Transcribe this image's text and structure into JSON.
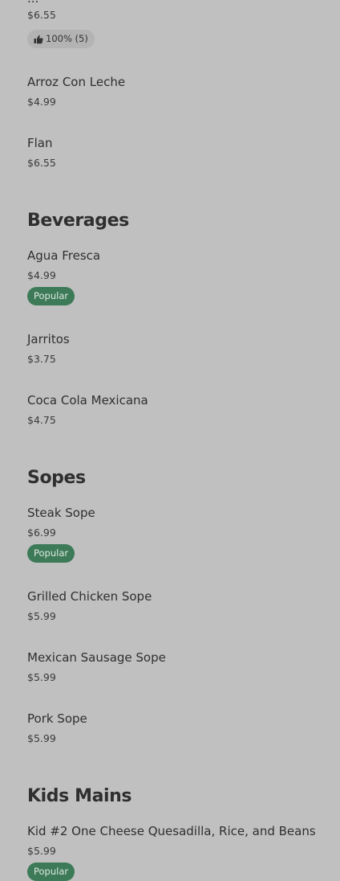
{
  "top_item": {
    "name": "...",
    "price": "$6.55",
    "rating": {
      "text": "100% (5)",
      "icon": "thumbs-up-icon"
    }
  },
  "desserts": [
    {
      "name": "Arroz Con Leche",
      "price": "$4.99"
    },
    {
      "name": "Flan",
      "price": "$6.55"
    }
  ],
  "sections": {
    "beverages": {
      "title": "Beverages",
      "items": [
        {
          "name": "Agua Fresca",
          "price": "$4.99",
          "badge": "Popular"
        },
        {
          "name": "Jarritos",
          "price": "$3.75"
        },
        {
          "name": "Coca Cola Mexicana",
          "price": "$4.75"
        }
      ]
    },
    "sopes": {
      "title": "Sopes",
      "items": [
        {
          "name": "Steak Sope",
          "price": "$6.99",
          "badge": "Popular"
        },
        {
          "name": "Grilled Chicken Sope",
          "price": "$5.99"
        },
        {
          "name": "Mexican Sausage Sope",
          "price": "$5.99"
        },
        {
          "name": "Pork Sope",
          "price": "$5.99"
        }
      ]
    },
    "kids_mains": {
      "title": "Kids Mains",
      "items": [
        {
          "name": "Kid #2 One Cheese Quesadilla, Rice, and Beans",
          "price": "$5.99",
          "badge": "Popular"
        }
      ]
    }
  },
  "colors": {
    "background": "#c0c0c0",
    "popular_badge": "#3c7a58",
    "rating_badge": "#b3b3b3"
  }
}
